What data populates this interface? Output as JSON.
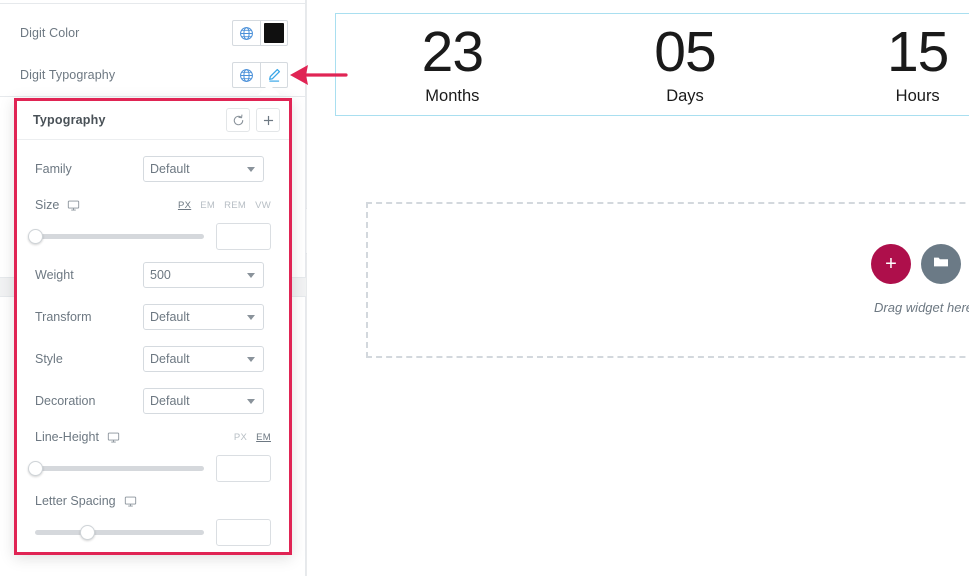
{
  "panel": {
    "rows": [
      {
        "label": "Digit Color",
        "globe_icon": "globe-icon",
        "value_icon": "color-swatch",
        "swatch_color": "#101010"
      },
      {
        "label": "Digit Typography",
        "globe_icon": "globe-icon",
        "value_icon": "pencil-edit-icon"
      }
    ],
    "collapse_label": "‹"
  },
  "popover": {
    "title": "Typography",
    "reset_icon": "reset-icon",
    "reset_glyph": "↺",
    "add_icon": "plus-icon",
    "add_glyph": "+",
    "fields": [
      {
        "label": "Family",
        "value": "Default",
        "type": "select"
      },
      {
        "label": "Weight",
        "value": "500",
        "type": "select"
      },
      {
        "label": "Transform",
        "value": "Default",
        "type": "select"
      },
      {
        "label": "Style",
        "value": "Default",
        "type": "select"
      },
      {
        "label": "Decoration",
        "value": "Default",
        "type": "select"
      }
    ],
    "size": {
      "label": "Size",
      "responsive_icon": "desktop-monitor-icon",
      "units": [
        "PX",
        "EM",
        "REM",
        "VW"
      ],
      "active_unit": "PX",
      "slider_percent": 0,
      "input_value": "",
      "input_placeholder": ""
    },
    "line_height": {
      "label": "Line-Height",
      "responsive_icon": "desktop-monitor-icon",
      "units": [
        "PX",
        "EM"
      ],
      "active_unit": "EM",
      "slider_percent": 0,
      "input_value": "",
      "input_placeholder": ""
    },
    "letter_spacing": {
      "label": "Letter Spacing",
      "responsive_icon": "desktop-monitor-icon",
      "units": [],
      "active_unit": "",
      "slider_percent": 31,
      "input_value": "",
      "input_placeholder": ""
    },
    "highlight_color": "#e02454"
  },
  "annotation": {
    "arrow_color": "#e02454",
    "arrow_icon": "left-arrow-annotation"
  },
  "canvas": {
    "countdown": {
      "border_color": "#a9dff0",
      "items": [
        {
          "digit": "23",
          "label": "Months"
        },
        {
          "digit": "05",
          "label": "Days"
        },
        {
          "digit": "15",
          "label": "Hours"
        }
      ]
    },
    "dropzone": {
      "add_button_label": "+",
      "add_button_color": "#ae0f4b",
      "folder_button_icon": "folder-icon",
      "folder_button_color": "#6b7a86",
      "hint_text": "Drag widget here"
    }
  }
}
